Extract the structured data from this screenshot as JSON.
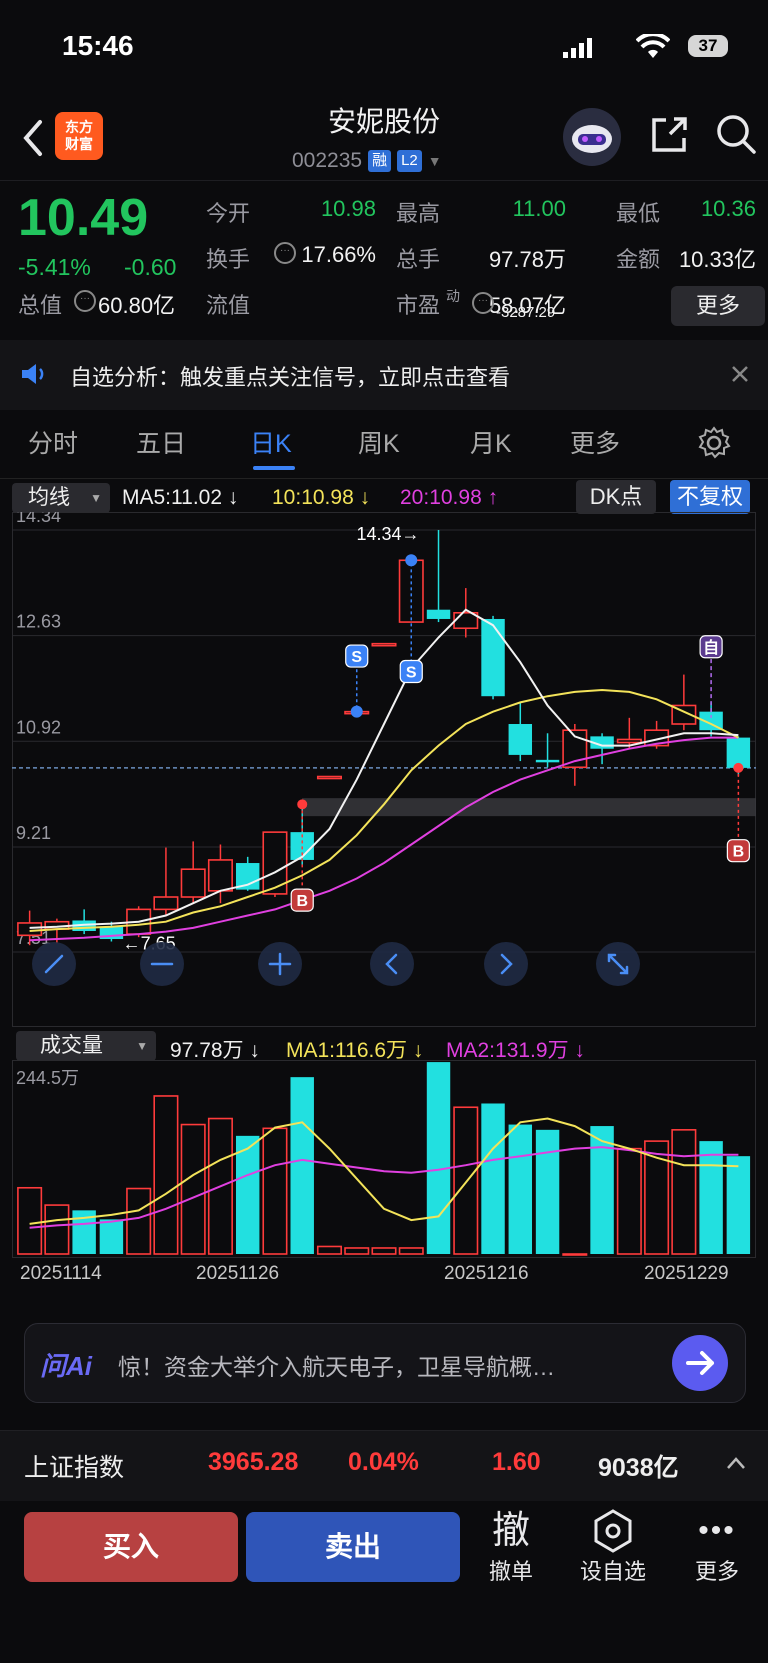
{
  "status": {
    "time": "15:46",
    "battery": "37"
  },
  "header": {
    "name": "安妮股份",
    "code": "002235",
    "tag_margin": "融",
    "tag_l2": "L2",
    "logo_text_1": "东方",
    "logo_text_2": "财富"
  },
  "quote": {
    "price": "10.49",
    "pct": "-5.41%",
    "chg": "-0.60",
    "fields": [
      {
        "label": "今开",
        "value": "10.98",
        "color": "#22c55e"
      },
      {
        "label": "最高",
        "value": "11.00",
        "color": "#22c55e"
      },
      {
        "label": "最低",
        "value": "10.36",
        "color": "#22c55e"
      },
      {
        "label": "换手",
        "value": "17.66%",
        "color": "#f2f2f2"
      },
      {
        "label": "总手",
        "value": "97.78万",
        "color": "#f2f2f2"
      },
      {
        "label": "金额",
        "value": "10.33亿",
        "color": "#f2f2f2"
      },
      {
        "label": "总值",
        "value": "60.80亿",
        "color": "#f2f2f2"
      },
      {
        "label": "流值",
        "value": "58.07亿",
        "color": "#f2f2f2"
      },
      {
        "label": "市盈",
        "value": "-3287.29",
        "color": "#f2f2f2"
      }
    ],
    "pe_sup": "动",
    "more": "更多"
  },
  "notice": {
    "text": "自选分析：触发重点关注信号，立即点击查看"
  },
  "tabs": [
    "分时",
    "五日",
    "日K",
    "周K",
    "月K",
    "更多"
  ],
  "ma_bar": {
    "select": "均线",
    "ma5": "MA5:11.02",
    "ma10": "10:10.98",
    "ma20": "20:10.98",
    "dk": "DK点",
    "fq": "不复权"
  },
  "chart_data": {
    "type": "candlestick",
    "y_ticks": [
      "14.34",
      "12.63",
      "10.92",
      "9.21",
      "7.51"
    ],
    "high_label": "14.34",
    "low_label": "7.65",
    "signals": [
      "S",
      "S",
      "B",
      "B",
      "自"
    ],
    "candles": [
      {
        "o": 7.78,
        "c": 7.98,
        "h": 8.18,
        "l": 7.62
      },
      {
        "o": 7.88,
        "c": 8.0,
        "h": 8.05,
        "l": 7.65
      },
      {
        "o": 8.02,
        "c": 7.85,
        "h": 8.2,
        "l": 7.8
      },
      {
        "o": 7.92,
        "c": 7.72,
        "h": 8.0,
        "l": 7.68
      },
      {
        "o": 7.8,
        "c": 8.2,
        "h": 8.25,
        "l": 7.75
      },
      {
        "o": 8.2,
        "c": 8.4,
        "h": 9.2,
        "l": 8.1
      },
      {
        "o": 8.4,
        "c": 8.85,
        "h": 9.3,
        "l": 8.3
      },
      {
        "o": 8.5,
        "c": 9.0,
        "h": 9.25,
        "l": 8.3
      },
      {
        "o": 8.95,
        "c": 8.52,
        "h": 9.05,
        "l": 8.5
      },
      {
        "o": 8.45,
        "c": 9.45,
        "h": 9.45,
        "l": 8.4
      },
      {
        "o": 9.45,
        "c": 9.0,
        "h": 9.92,
        "l": 8.9
      },
      {
        "o": 10.35,
        "c": 10.35,
        "h": 10.35,
        "l": 10.35
      },
      {
        "o": 11.4,
        "c": 11.4,
        "h": 11.4,
        "l": 11.4
      },
      {
        "o": 12.5,
        "c": 12.5,
        "h": 12.5,
        "l": 12.5
      },
      {
        "o": 12.85,
        "c": 13.85,
        "h": 13.85,
        "l": 12.85
      },
      {
        "o": 13.05,
        "c": 12.9,
        "h": 14.34,
        "l": 12.85
      },
      {
        "o": 12.75,
        "c": 13.0,
        "h": 13.4,
        "l": 12.6
      },
      {
        "o": 12.9,
        "c": 11.65,
        "h": 12.95,
        "l": 11.6
      },
      {
        "o": 11.2,
        "c": 10.7,
        "h": 11.55,
        "l": 10.6
      },
      {
        "o": 10.62,
        "c": 10.58,
        "h": 11.05,
        "l": 10.5
      },
      {
        "o": 10.5,
        "c": 11.1,
        "h": 11.2,
        "l": 10.2
      },
      {
        "o": 11.0,
        "c": 10.8,
        "h": 11.05,
        "l": 10.55
      },
      {
        "o": 10.9,
        "c": 10.95,
        "h": 11.3,
        "l": 10.8
      },
      {
        "o": 10.85,
        "c": 11.1,
        "h": 11.25,
        "l": 10.8
      },
      {
        "o": 11.2,
        "c": 11.5,
        "h": 12.0,
        "l": 11.1
      },
      {
        "o": 11.4,
        "c": 11.1,
        "h": 11.55,
        "l": 11.0
      },
      {
        "o": 10.98,
        "c": 10.49,
        "h": 11.0,
        "l": 10.36
      }
    ],
    "ma5": [
      7.9,
      7.92,
      7.95,
      7.97,
      8.0,
      8.1,
      8.3,
      8.5,
      8.6,
      8.8,
      9.05,
      9.5,
      10.3,
      11.2,
      12.1,
      12.6,
      13.05,
      12.8,
      12.2,
      11.5,
      11.0,
      10.85,
      10.85,
      10.95,
      11.05,
      11.05,
      11.02
    ],
    "ma10": [
      7.85,
      7.88,
      7.9,
      7.92,
      7.95,
      8.0,
      8.15,
      8.25,
      8.4,
      8.55,
      8.75,
      9.0,
      9.4,
      9.9,
      10.45,
      10.85,
      11.2,
      11.4,
      11.55,
      11.65,
      11.72,
      11.75,
      11.72,
      11.6,
      11.4,
      11.2,
      10.98
    ],
    "ma20": [
      7.7,
      7.72,
      7.74,
      7.77,
      7.8,
      7.84,
      7.9,
      8.0,
      8.1,
      8.2,
      8.35,
      8.5,
      8.7,
      8.95,
      9.25,
      9.55,
      9.85,
      10.1,
      10.3,
      10.45,
      10.6,
      10.7,
      10.8,
      10.88,
      10.94,
      10.98,
      10.98
    ]
  },
  "vol_bar": {
    "select": "成交量",
    "vol": "97.78万",
    "ma1": "MA1:116.6万",
    "ma2": "MA2:131.9万",
    "ymax_label": "244.5万"
  },
  "vol_data": {
    "ymax": 244.5,
    "values": [
      88,
      65,
      58,
      46,
      87,
      210,
      172,
      180,
      157,
      167,
      235,
      10,
      8,
      8,
      8,
      255,
      195,
      200,
      172,
      165,
      0,
      170,
      140,
      150,
      165,
      150,
      130
    ],
    "ma1": [
      40,
      45,
      48,
      52,
      58,
      80,
      105,
      125,
      140,
      168,
      175,
      140,
      100,
      60,
      45,
      50,
      95,
      140,
      175,
      180,
      170,
      150,
      140,
      128,
      118,
      118,
      116.6
    ],
    "ma2": [
      35,
      38,
      40,
      43,
      48,
      60,
      75,
      90,
      105,
      118,
      125,
      120,
      115,
      110,
      108,
      112,
      118,
      125,
      130,
      135,
      140,
      142,
      138,
      133,
      130,
      132,
      131.9
    ]
  },
  "dates": [
    "20251114",
    "20251126",
    "20251216",
    "20251229"
  ],
  "ai": {
    "brand": "问Ai",
    "text": "惊！资金大举介入航天电子，卫星导航概…"
  },
  "index_bar": {
    "name": "上证指数",
    "value": "3965.28",
    "pct": "0.04%",
    "chg": "1.60",
    "amount": "9038亿"
  },
  "bottom": {
    "buy": "买入",
    "sell": "卖出",
    "cancel_top": "撤",
    "cancel": "撤单",
    "watch": "设自选",
    "more": "更多"
  }
}
